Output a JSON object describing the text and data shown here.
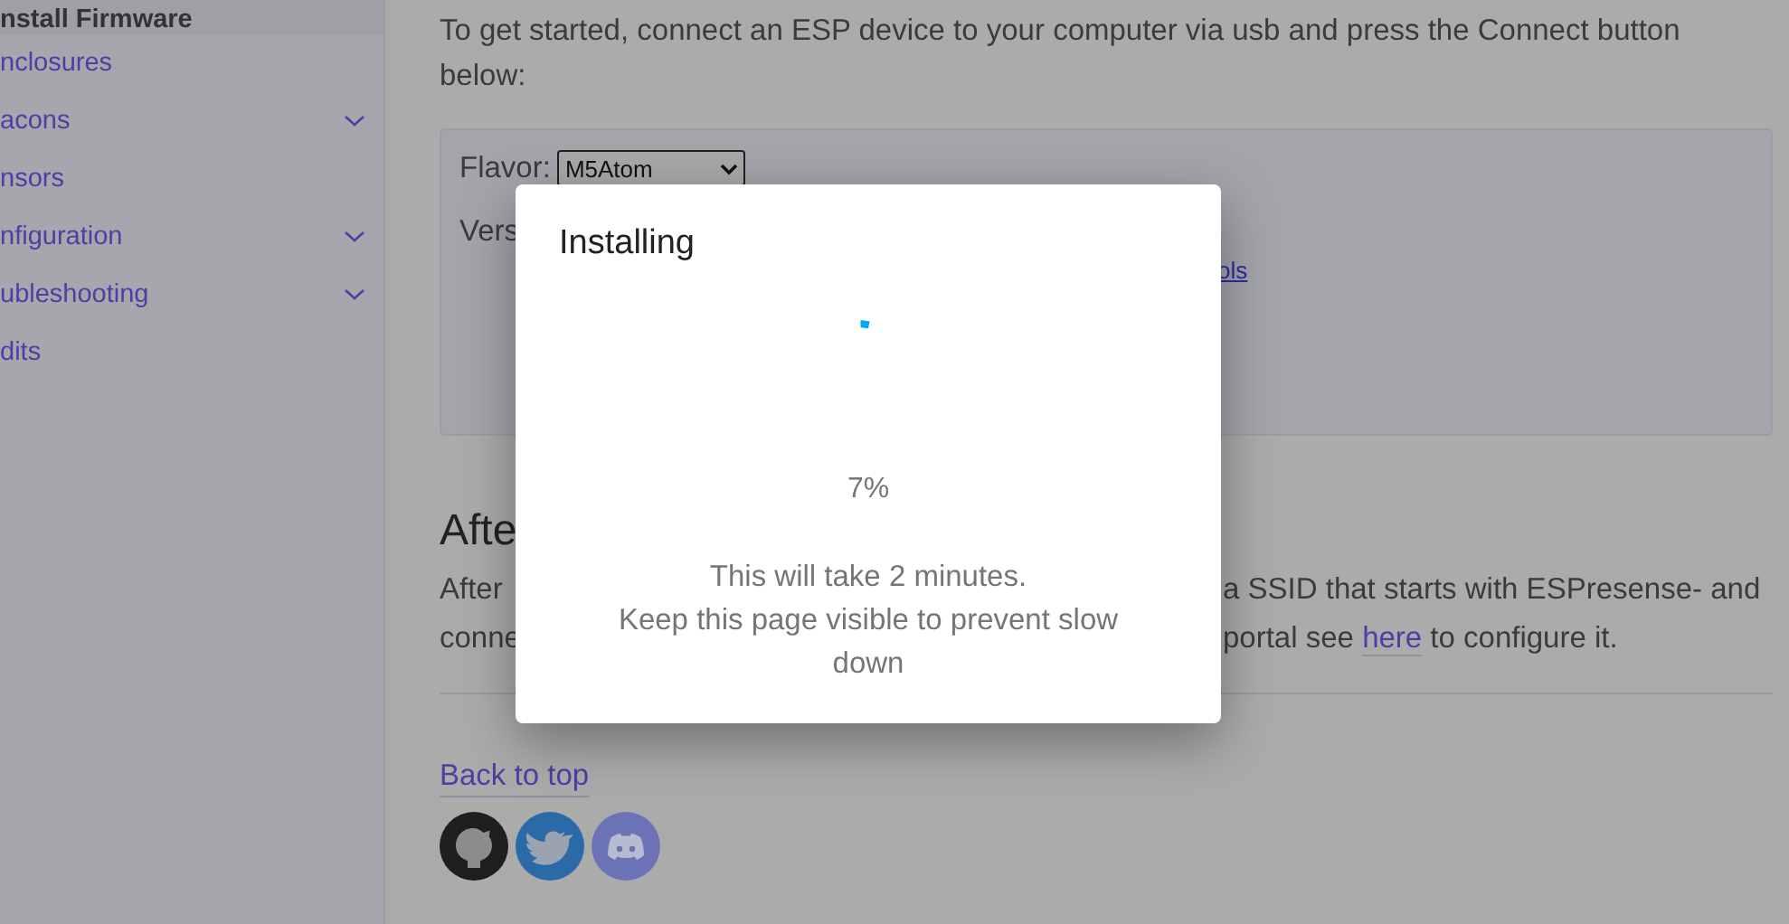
{
  "sidebar": {
    "items": [
      {
        "label": "nstall Firmware",
        "selected": true,
        "expandable": false
      },
      {
        "label": "nclosures",
        "selected": false,
        "expandable": false
      },
      {
        "label": "acons",
        "selected": false,
        "expandable": true
      },
      {
        "label": "nsors",
        "selected": false,
        "expandable": false
      },
      {
        "label": "nfiguration",
        "selected": false,
        "expandable": true
      },
      {
        "label": "ubleshooting",
        "selected": false,
        "expandable": true
      },
      {
        "label": "dits",
        "selected": false,
        "expandable": false
      }
    ]
  },
  "content": {
    "intro": "To get started, connect an ESP device to your computer via usb and press the Connect button below:",
    "installer": {
      "flavor_label": "Flavor:",
      "flavor_value": "M5Atom",
      "version_label": "Vers",
      "link": "ols"
    },
    "after_heading": "Afte",
    "after_lines": [
      {
        "left": "After",
        "right": "a SSID that starts with ESPresense- and"
      },
      {
        "left": "conne",
        "right": "portal see",
        "link": "here",
        "after": "to configure it."
      }
    ],
    "back_to_top": "Back to top",
    "social": [
      {
        "kind": "github"
      },
      {
        "kind": "twitter"
      },
      {
        "kind": "discord"
      }
    ]
  },
  "dialog": {
    "title": "Installing",
    "progress": "7%",
    "message_lines": [
      "This will take 2 minutes.",
      "Keep this page visible to prevent slow down"
    ]
  }
}
